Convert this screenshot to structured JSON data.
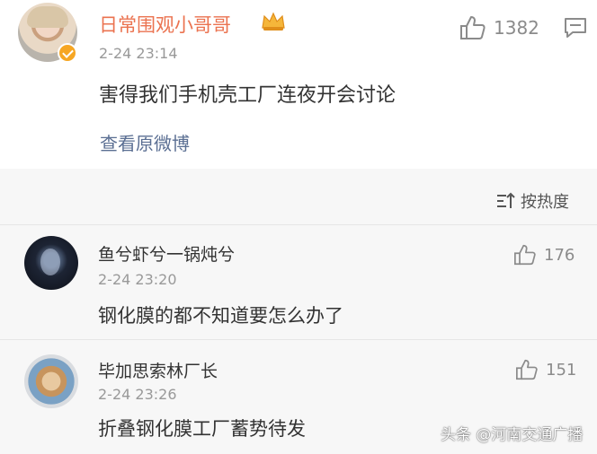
{
  "post": {
    "author_name": "日常围观小哥哥",
    "timestamp": "2-24 23:14",
    "text": "害得我们手机壳工厂连夜开会讨论",
    "view_original_link": "查看原微博",
    "like_count": "1382",
    "badge_icon": "crown-icon",
    "verified_icon": "verified-badge-icon"
  },
  "comments_header": {
    "sort_label": "按热度",
    "sort_icon": "sort-icon"
  },
  "comments": [
    {
      "author_name": "鱼兮虾兮一锅炖兮",
      "timestamp": "2-24 23:20",
      "text": "钢化膜的都不知道要怎么办了",
      "like_count": "176"
    },
    {
      "author_name": "毕加思索林厂长",
      "timestamp": "2-24 23:26",
      "text": "折叠钢化膜工厂蓄势待发",
      "like_count": "151"
    }
  ],
  "watermark": "头条 @河南交通广播",
  "colors": {
    "author_highlight": "#eb7350",
    "link": "#5b6f93",
    "meta_gray": "#999999",
    "comments_background": "#f7f7f7"
  }
}
